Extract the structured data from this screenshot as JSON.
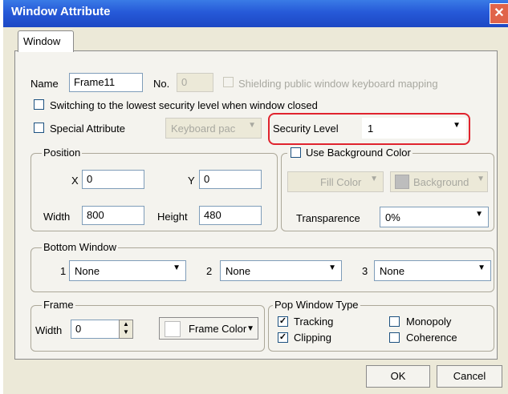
{
  "window": {
    "title": "Window Attribute",
    "close_glyph": "✕"
  },
  "tabs": [
    {
      "label": "Window"
    }
  ],
  "general": {
    "name_label": "Name",
    "name_value": "Frame11",
    "no_label": "No.",
    "no_value": "0",
    "shielding_label": "Shielding public window keyboard mapping",
    "switching_label": "Switching to the lowest security level when window closed",
    "special_label": "Special Attribute",
    "keyboard_value": "Keyboard pac",
    "security_label": "Security Level",
    "security_value": "1"
  },
  "position": {
    "title": "Position",
    "x_label": "X",
    "x_value": "0",
    "y_label": "Y",
    "y_value": "0",
    "width_label": "Width",
    "width_value": "800",
    "height_label": "Height",
    "height_value": "480"
  },
  "background": {
    "use_label": "Use Background Color",
    "fill_color_label": "Fill Color",
    "background_label": "Background",
    "transparence_label": "Transparence",
    "transparence_value": "0%"
  },
  "bottom_window": {
    "title": "Bottom Window",
    "items": [
      {
        "index": "1",
        "value": "None"
      },
      {
        "index": "2",
        "value": "None"
      },
      {
        "index": "3",
        "value": "None"
      }
    ]
  },
  "frame": {
    "title": "Frame",
    "width_label": "Width",
    "width_value": "0",
    "frame_color_label": "Frame Color"
  },
  "pop_window": {
    "title": "Pop Window Type",
    "tracking_label": "Tracking",
    "tracking_checked": true,
    "clipping_label": "Clipping",
    "clipping_checked": true,
    "monopoly_label": "Monopoly",
    "monopoly_checked": false,
    "coherence_label": "Coherence",
    "coherence_checked": false
  },
  "buttons": {
    "ok": "OK",
    "cancel": "Cancel"
  },
  "colors": {
    "highlight": "#e0232e",
    "titlebar": "#2659d8"
  }
}
